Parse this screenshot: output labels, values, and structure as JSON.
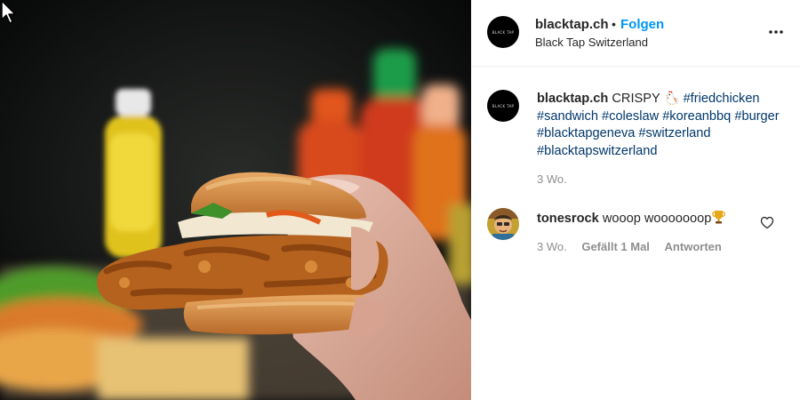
{
  "header": {
    "username": "blacktap.ch",
    "separator": "•",
    "follow_label": "Folgen",
    "location": "Black Tap Switzerland",
    "avatar_text": "BLACK TAP"
  },
  "caption": {
    "username": "blacktap.ch",
    "text": "CRISPY",
    "emoji": "rooster-emoji",
    "hashtags": [
      "#friedchicken",
      "#sandwich",
      "#coleslaw",
      "#koreanbbq",
      "#burger",
      "#blacktapgeneva",
      "#switzerland",
      "#blacktapswitzerland"
    ],
    "time": "3 Wo."
  },
  "comment": {
    "username": "tonesrock",
    "text": "wooop wooooooop",
    "emoji": "trophy-emoji",
    "time": "3 Wo.",
    "likes": "Gefällt 1 Mal",
    "reply_label": "Antworten"
  },
  "icons": {
    "more": "more-options-icon",
    "like": "heart-icon",
    "cursor": "mouse-cursor-icon"
  },
  "colors": {
    "link": "#0095f6",
    "hashtag": "#00376b",
    "muted": "#8e8e8e",
    "text": "#262626"
  }
}
